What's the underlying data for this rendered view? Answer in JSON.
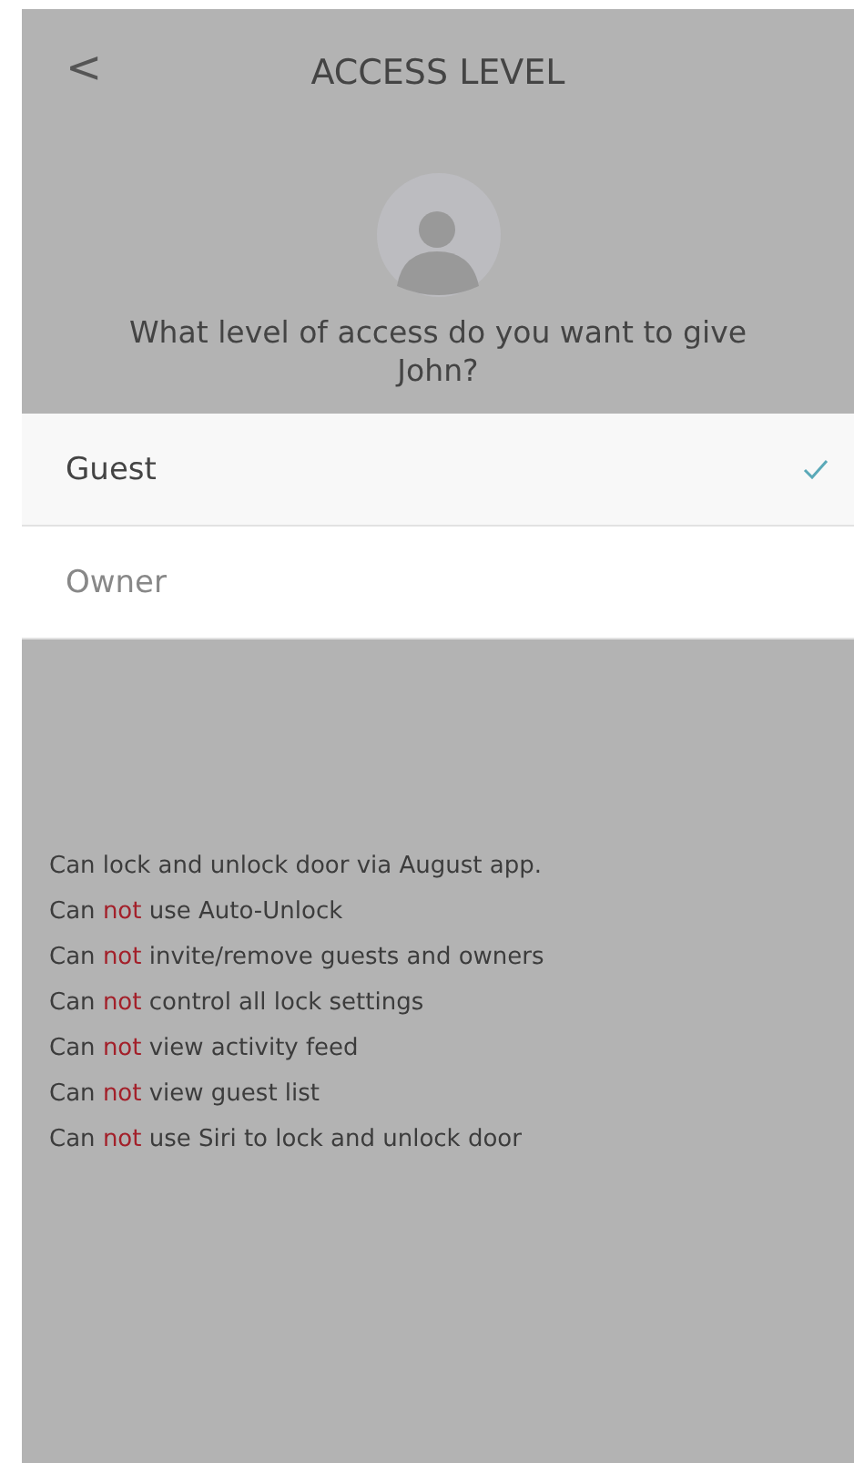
{
  "header": {
    "back": "<",
    "title": "ACCESS LEVEL"
  },
  "question": "What level of access do you want to give John?",
  "options": [
    {
      "label": "Guest",
      "selected": true
    },
    {
      "label": "Owner",
      "selected": false
    }
  ],
  "permissions": [
    {
      "before": "Can lock and unlock door via August app."
    },
    {
      "before": "Can",
      "highlight": "not",
      "after": "use Auto-Unlock"
    },
    {
      "before": "Can",
      "highlight": "not",
      "after": "invite/remove guests and owners"
    },
    {
      "before": "Can",
      "highlight": "not",
      "after": "control all lock settings"
    },
    {
      "before": "Can",
      "highlight": "not",
      "after": "view activity feed"
    },
    {
      "before": "Can",
      "highlight": "not",
      "after": "view guest list"
    },
    {
      "before": "Can",
      "highlight": "not",
      "after": "use Siri to lock and unlock door"
    }
  ]
}
